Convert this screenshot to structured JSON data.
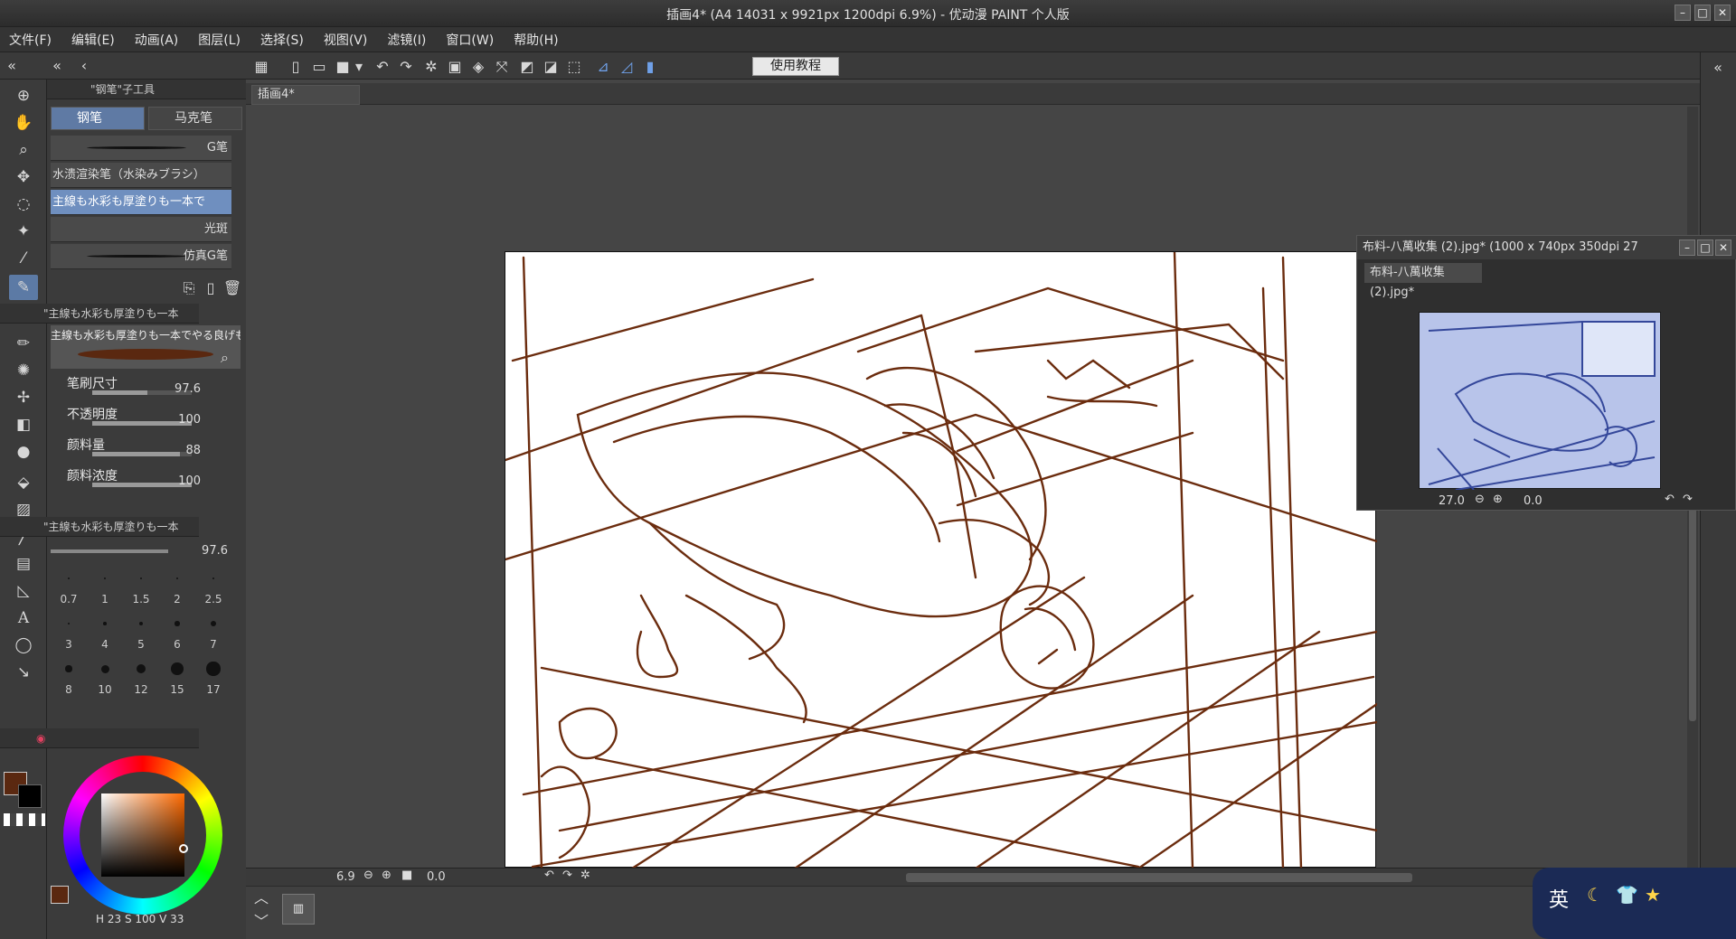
{
  "window": {
    "title": "插画4* (A4 14031 x 9921px 1200dpi 6.9%) - 优动漫 PAINT 个人版"
  },
  "menu": [
    "文件(F)",
    "编辑(E)",
    "动画(A)",
    "图层(L)",
    "选择(S)",
    "视图(V)",
    "滤镜(I)",
    "窗口(W)",
    "帮助(H)"
  ],
  "toolbar": {
    "tutorial_label": "使用教程"
  },
  "subtool": {
    "header": "\"钢笔\"子工具",
    "tabs": [
      "钢笔",
      "马克笔"
    ],
    "brushes": [
      {
        "name": "G笔"
      },
      {
        "name": "水溃渲染笔（水染みブラシ）"
      },
      {
        "name": "主線も水彩も厚塗りも一本で"
      },
      {
        "name": "光斑"
      },
      {
        "name": "仿真G笔"
      }
    ]
  },
  "tool_property": {
    "header": "\"主線も水彩も厚塗りも一本",
    "brush_name": "主線も水彩も厚塗りも一本でやる良げも",
    "props": [
      {
        "label": "笔刷尺寸",
        "value": "97.6",
        "level": 0.55
      },
      {
        "label": "不透明度",
        "value": "100",
        "level": 1.0
      },
      {
        "label": "颜料量",
        "value": "88",
        "level": 0.88
      },
      {
        "label": "颜料浓度",
        "value": "100",
        "level": 1.0
      }
    ]
  },
  "brush_size_panel": {
    "header": "\"主線も水彩も厚塗りも一本",
    "current": "97.6",
    "sizes": [
      "0.7",
      "1",
      "1.5",
      "2",
      "2.5",
      "3",
      "4",
      "5",
      "6",
      "7",
      "8",
      "10",
      "12",
      "15",
      "17"
    ]
  },
  "color": {
    "main": "#5a2810",
    "sub": "#000000",
    "h": "23",
    "s": "100",
    "v": "33"
  },
  "document": {
    "tab": "插画4*",
    "stroke_color": "#6b2c0e"
  },
  "status": {
    "zoom": "6.9",
    "angle": "0.0"
  },
  "navigator": {
    "title": "布料-八萬收集 (2).jpg* (1000 x 740px 350dpi 27",
    "tab": "布料-八萬收集 (2).jpg*",
    "zoom": "27.0",
    "angle": "0.0"
  },
  "ime": {
    "mode": "英"
  }
}
